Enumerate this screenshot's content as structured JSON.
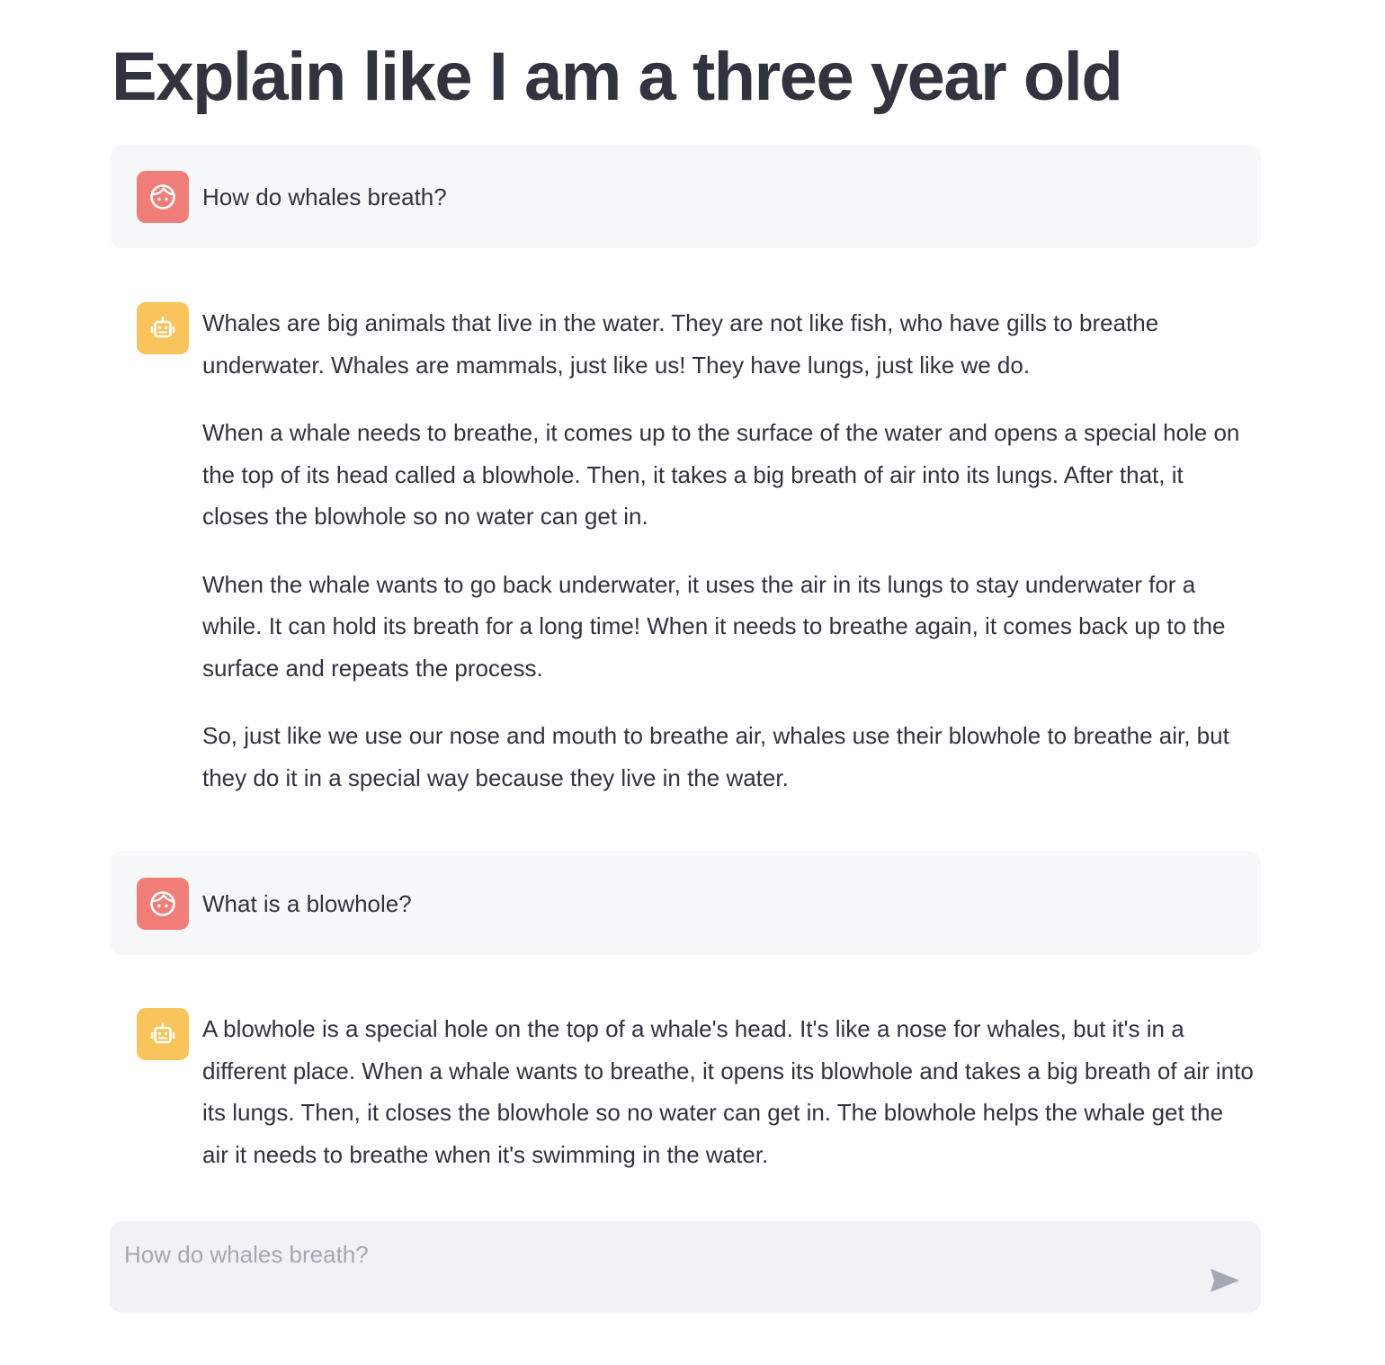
{
  "page": {
    "title": "Explain like I am a three year old"
  },
  "messages": [
    {
      "role": "user",
      "avatar_icon": "face-smile-icon",
      "paragraphs": [
        "How do whales breath?"
      ]
    },
    {
      "role": "assistant",
      "avatar_icon": "robot-icon",
      "paragraphs": [
        "Whales are big animals that live in the water. They are not like fish, who have gills to breathe underwater. Whales are mammals, just like us! They have lungs, just like we do.",
        "When a whale needs to breathe, it comes up to the surface of the water and opens a special hole on the top of its head called a blowhole. Then, it takes a big breath of air into its lungs. After that, it closes the blowhole so no water can get in.",
        "When the whale wants to go back underwater, it uses the air in its lungs to stay underwater for a while. It can hold its breath for a long time! When it needs to breathe again, it comes back up to the surface and repeats the process.",
        "So, just like we use our nose and mouth to breathe air, whales use their blowhole to breathe air, but they do it in a special way because they live in the water."
      ]
    },
    {
      "role": "user",
      "avatar_icon": "face-smile-icon",
      "paragraphs": [
        "What is a blowhole?"
      ]
    },
    {
      "role": "assistant",
      "avatar_icon": "robot-icon",
      "paragraphs": [
        "A blowhole is a special hole on the top of a whale's head. It's like a nose for whales, but it's in a different place. When a whale wants to breathe, it opens its blowhole and takes a big breath of air into its lungs. Then, it closes the blowhole so no water can get in. The blowhole helps the whale get the air it needs to breathe when it's swimming in the water."
      ]
    }
  ],
  "chat_input": {
    "value": "",
    "placeholder": "How do whales breath?",
    "send_icon": "send-icon"
  },
  "colors": {
    "user_avatar": "#f07d78",
    "assistant_avatar": "#f8c45b",
    "user_message_bg": "#f7f8fa",
    "input_bg": "#f0f2f6",
    "text": "#31333f",
    "placeholder": "#a3a8b4",
    "send_icon": "#a3a8b4"
  }
}
